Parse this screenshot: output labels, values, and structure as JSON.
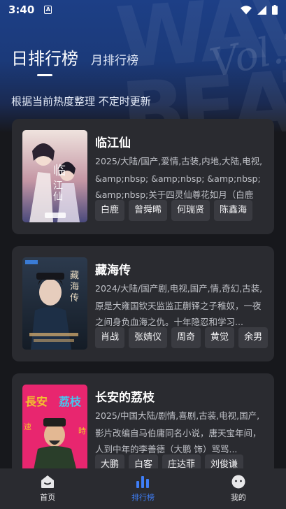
{
  "status_bar": {
    "time": "3:40",
    "notif_glyph": "A"
  },
  "tabs": [
    {
      "label": "日排行榜",
      "active": true
    },
    {
      "label": "月排行榜",
      "active": false
    }
  ],
  "subtitle": "根据当前热度整理 不定时更新",
  "dramas": [
    {
      "title": "临江仙",
      "meta": "2025/大陆/国产,爱情,古装,内地,大陆,电视,",
      "desc": "&amp;nbsp; &amp;nbsp; &amp;nbsp; &amp;nbsp;关于四灵仙尊花如月（白鹿 ...",
      "tags": [
        "白鹿",
        "曾舜晞",
        "何瑞贤",
        "陈鑫海"
      ],
      "poster_colors": [
        "#e9d8d2",
        "#b07a8a",
        "#3d3d6e"
      ]
    },
    {
      "title": "藏海传",
      "meta": "2024/大陆/国产剧,电视,国产,情,奇幻,古装,",
      "desc": "原是大雍国钦天监监正蒯铎之子稚奴，一夜之间身负血海之仇。十年隐忍和学习...",
      "tags": [
        "肖战",
        "张婧仪",
        "周奇",
        "黄觉",
        "余男"
      ],
      "poster_colors": [
        "#1e2a3a",
        "#3b5068",
        "#c9a46a"
      ]
    },
    {
      "title": "长安的荔枝",
      "meta": "2025/中国大陆/剧情,喜剧,古装,电视,国产,",
      "desc": "影片改编自马伯庸同名小说，唐天宝年间，人到中年的李善德（大鹏 饰）骂骂...",
      "tags": [
        "大鹏",
        "白客",
        "庄达菲",
        "刘俊谦"
      ],
      "poster_colors": [
        "#e8266f",
        "#f2c12e",
        "#2a3e2a"
      ]
    }
  ],
  "bottom_nav": [
    {
      "label": "首页",
      "icon": "home-icon",
      "active": false
    },
    {
      "label": "排行榜",
      "icon": "ranking-chart-icon",
      "active": true
    },
    {
      "label": "我的",
      "icon": "profile-face-icon",
      "active": false
    }
  ],
  "colors": {
    "accent": "#3f7ef6",
    "card": "#2a2b30",
    "tag": "#3a3b41"
  }
}
